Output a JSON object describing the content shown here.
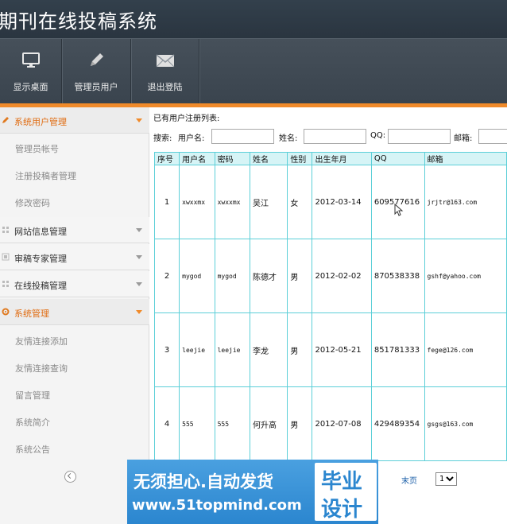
{
  "app": {
    "title": "期刊在线投稿系统"
  },
  "toolbar": {
    "items": [
      {
        "label": "显示桌面",
        "icon": "monitor-icon"
      },
      {
        "label": "管理员用户",
        "icon": "pencil-icon"
      },
      {
        "label": "退出登陆",
        "icon": "envelope-icon"
      }
    ]
  },
  "sidebar": {
    "groups": [
      {
        "label": "系统用户管理",
        "icon": "pencil-icon",
        "active": true,
        "items": [
          "管理员帐号",
          "注册投稿者管理",
          "修改密码"
        ]
      },
      {
        "label": "网站信息管理",
        "icon": "grid-icon",
        "active": false,
        "items": []
      },
      {
        "label": "审稿专家管理",
        "icon": "grid-icon",
        "active": false,
        "items": []
      },
      {
        "label": "在线投稿管理",
        "icon": "grid-icon",
        "active": false,
        "items": []
      },
      {
        "label": "系统管理",
        "icon": "gear-icon",
        "active": true,
        "items": [
          "友情连接添加",
          "友情连接查询",
          "留言管理",
          "系统简介",
          "系统公告"
        ]
      }
    ]
  },
  "main": {
    "caption": "已有用户注册列表:",
    "search": {
      "label": "搜索:",
      "username_label": "用户名:",
      "name_label": "姓名:",
      "qq_label": "QQ:",
      "email_label": "邮箱:",
      "username_value": "",
      "name_value": "",
      "qq_value": "",
      "email_value": ""
    },
    "table": {
      "headers": [
        "序号",
        "用户名",
        "密码",
        "姓名",
        "性别",
        "出生年月",
        "QQ",
        "邮箱"
      ],
      "rows": [
        [
          "1",
          "xwxxmx",
          "xwxxmx",
          "吴江",
          "女",
          "2012-03-14",
          "609577616",
          "jrjtr@163.com"
        ],
        [
          "2",
          "mygod",
          "mygod",
          "陈德才",
          "男",
          "2012-02-02",
          "870538338",
          "gshf@yahoo.com"
        ],
        [
          "3",
          "leejie",
          "leejie",
          "李龙",
          "男",
          "2012-05-21",
          "851781333",
          "fege@126.com"
        ],
        [
          "4",
          "555",
          "555",
          "何升高",
          "男",
          "2012-07-08",
          "429489354",
          "gsgs@163.com"
        ]
      ]
    },
    "pager": {
      "last_label": "末页",
      "page_value": "1"
    }
  },
  "banner": {
    "line1": "无须担心.自动发货",
    "line2": "www.51topmind.com",
    "badge1": "毕业",
    "badge2": "设计"
  },
  "colors": {
    "accent": "#f08a2a",
    "header": "#2f3b46",
    "grid_border": "#5ccfd8",
    "grid_header": "#d6f4f6"
  }
}
